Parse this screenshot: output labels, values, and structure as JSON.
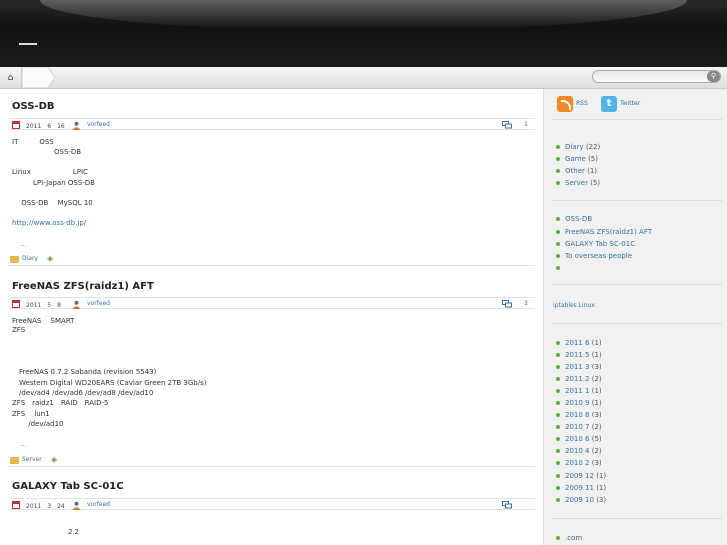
{
  "nav": {
    "home_icon": "home-icon",
    "search_placeholder": ""
  },
  "posts": [
    {
      "title": "OSS-DB",
      "date": "2011　6　16",
      "author": "vorfeed",
      "comments": "1",
      "body": [
        "IT　　　OSS",
        "　　　　　　OSS-DB",
        "",
        "Linux　　　　　　LPIC",
        "　　　LPI-Japan OSS-DB",
        "",
        "　 OSS-DB　 MySQL 10",
        "",
        "http://www.oss-db.jp/"
      ],
      "more": "…",
      "category": "Diary"
    },
    {
      "title": "FreeNAS ZFS(raidz1) AFT",
      "date": "2011　5　8",
      "author": "vorfeed",
      "comments": "3",
      "body": [
        "FreeNAS　 SMART",
        "ZFS",
        "",
        "",
        "",
        "　FreeNAS 0.7.2 Sabanda (revision 5543)",
        "　Western Digital WD20EARS (Caviar Green 2TB 3Gb/s)",
        "　/dev/ad4 /dev/ad6 /dev/ad8 /dev/ad10",
        "ZFS　raidz1　RAID　RAID-5",
        "ZFS　 lun1",
        "　　 /dev/ad10"
      ],
      "more": "…",
      "category": "Server"
    },
    {
      "title": "GALAXY Tab SC-01C",
      "date": "2011　3　24",
      "author": "vorfeed",
      "body": [
        "",
        "　　　　　　　　2.2"
      ]
    }
  ],
  "sidebar": {
    "rss_label": "RSS",
    "twitter_label": "Twitter",
    "categories": [
      {
        "name": "Diary",
        "count": "(22)"
      },
      {
        "name": "Game",
        "count": "(5)"
      },
      {
        "name": "Other",
        "count": "(1)"
      },
      {
        "name": "Server",
        "count": "(5)"
      }
    ],
    "recent": [
      "OSS-DB",
      "FreeNAS ZFS(raidz1) AFT",
      "GALAXY Tab SC-01C",
      "To overseas people",
      ""
    ],
    "blogroll_head": "iptables Linux",
    "archives": [
      {
        "name": "2011 6",
        "count": "(1)"
      },
      {
        "name": "2011 5",
        "count": "(1)"
      },
      {
        "name": "2011 3",
        "count": "(3)"
      },
      {
        "name": "2011 2",
        "count": "(2)"
      },
      {
        "name": "2011 1",
        "count": "(1)"
      },
      {
        "name": "2010 9",
        "count": "(1)"
      },
      {
        "name": "2010 8",
        "count": "(3)"
      },
      {
        "name": "2010 7",
        "count": "(2)"
      },
      {
        "name": "2010 6",
        "count": "(5)"
      },
      {
        "name": "2010 4",
        "count": "(2)"
      },
      {
        "name": "2010 2",
        "count": "(3)"
      },
      {
        "name": "2009 12",
        "count": "(1)"
      },
      {
        "name": "2009 11",
        "count": "(1)"
      },
      {
        "name": "2009 10",
        "count": "(3)"
      }
    ],
    "bottom_link": ".com"
  }
}
